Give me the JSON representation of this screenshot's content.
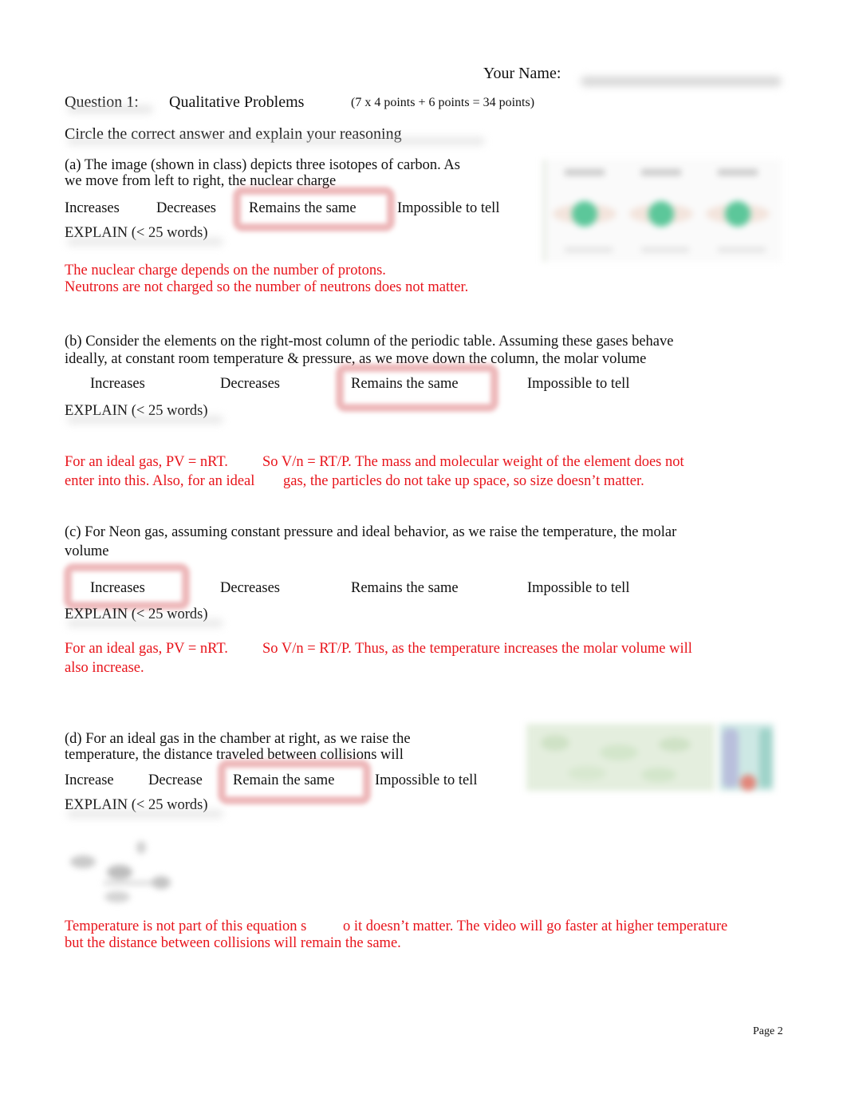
{
  "header": {
    "name_label": "Your Name:",
    "question_label": "Question 1:",
    "question_title": "Qualitative Problems",
    "points": "(7 x 4 points + 6 points = 34 points)",
    "instruction": "Circle the correct answer and explain your reasoning"
  },
  "explain_label": "EXPLAIN (< 25 words)",
  "parts": [
    {
      "id": "a",
      "prompt_line1": "(a)   The image (shown in class) depicts three isotopes of carbon. As",
      "prompt_line2": "we move from left to right, the nuclear charge",
      "options": [
        "Increases",
        "Decreases",
        "Remains the same",
        "Impossible to tell"
      ],
      "selected": "Remains the same",
      "answer_line1": "The nuclear charge depends on the number of protons.",
      "answer_line2": "Neutrons are not charged so the number of neutrons does not matter.",
      "image": "carbon-isotopes-image"
    },
    {
      "id": "b",
      "prompt_line1": "(b)   Consider the elements on the right-most column of the periodic table. Assuming these gases behave",
      "prompt_line2": "ideally,  at constant room temperature & pressure, as we move down the column, the molar volume",
      "options": [
        "Increases",
        "Decreases",
        "Remains the same",
        "Impossible to tell"
      ],
      "selected": "Remains the same",
      "answer_line1a": "For an ideal gas, PV = nRT.",
      "answer_line1b": "So V/n = RT/P. The mass and molecular weight of the element does not",
      "answer_line2a": "enter into this. Also, for an ideal",
      "answer_line2b": "gas, the particles do not take up space, so size doesn’t matter."
    },
    {
      "id": "c",
      "prompt_line1": "(c)   For Neon gas, assuming constant pressure and ideal behavior, as we raise the temperature, the molar",
      "prompt_line2": "volume",
      "options": [
        "Increases",
        "Decreases",
        "Remains the same",
        "Impossible to tell"
      ],
      "selected": "Increases",
      "answer_line1a": "For an ideal gas, PV = nRT.",
      "answer_line1b": "So V/n = RT/P. Thus, as the temperature increases the molar volume will",
      "answer_line2": "also increase."
    },
    {
      "id": "d",
      "prompt_line1": "(d)   For an ideal gas in the chamber at right, as we raise the",
      "prompt_line2": "temperature, the distance traveled between collisions will",
      "options": [
        "Increase",
        "Decrease",
        "Remain the same",
        "Impossible to tell"
      ],
      "selected": "Remain the same",
      "answer_line1a": "Temperature is not part of this equation s",
      "answer_line1b": "o it doesn’t matter. The video will go faster at higher temperature",
      "answer_line2": "but the distance between collisions will remain the same.",
      "image": "gas-chamber-image",
      "equation_image": "mean-free-path-equation-image"
    }
  ],
  "footer": {
    "page": "Page 2"
  },
  "colors": {
    "answer_red": "#e8141b",
    "circle": "#d65f64"
  }
}
